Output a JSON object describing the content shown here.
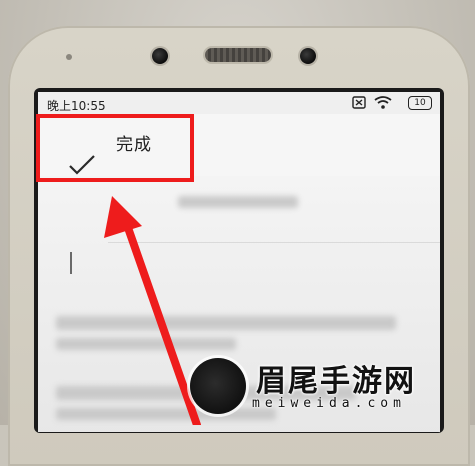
{
  "status_bar": {
    "time": "晚上10:55",
    "battery": "10",
    "icons": [
      "no-sim-icon",
      "wifi-icon",
      "battery-icon"
    ]
  },
  "toolbar": {
    "check_icon": "check-icon",
    "done_label": "完成"
  },
  "annotation": {
    "highlight_color": "#ee1c1c"
  },
  "watermark": {
    "logo": "feather-logo",
    "title": "眉尾手游网",
    "url": "meiweida.com"
  }
}
